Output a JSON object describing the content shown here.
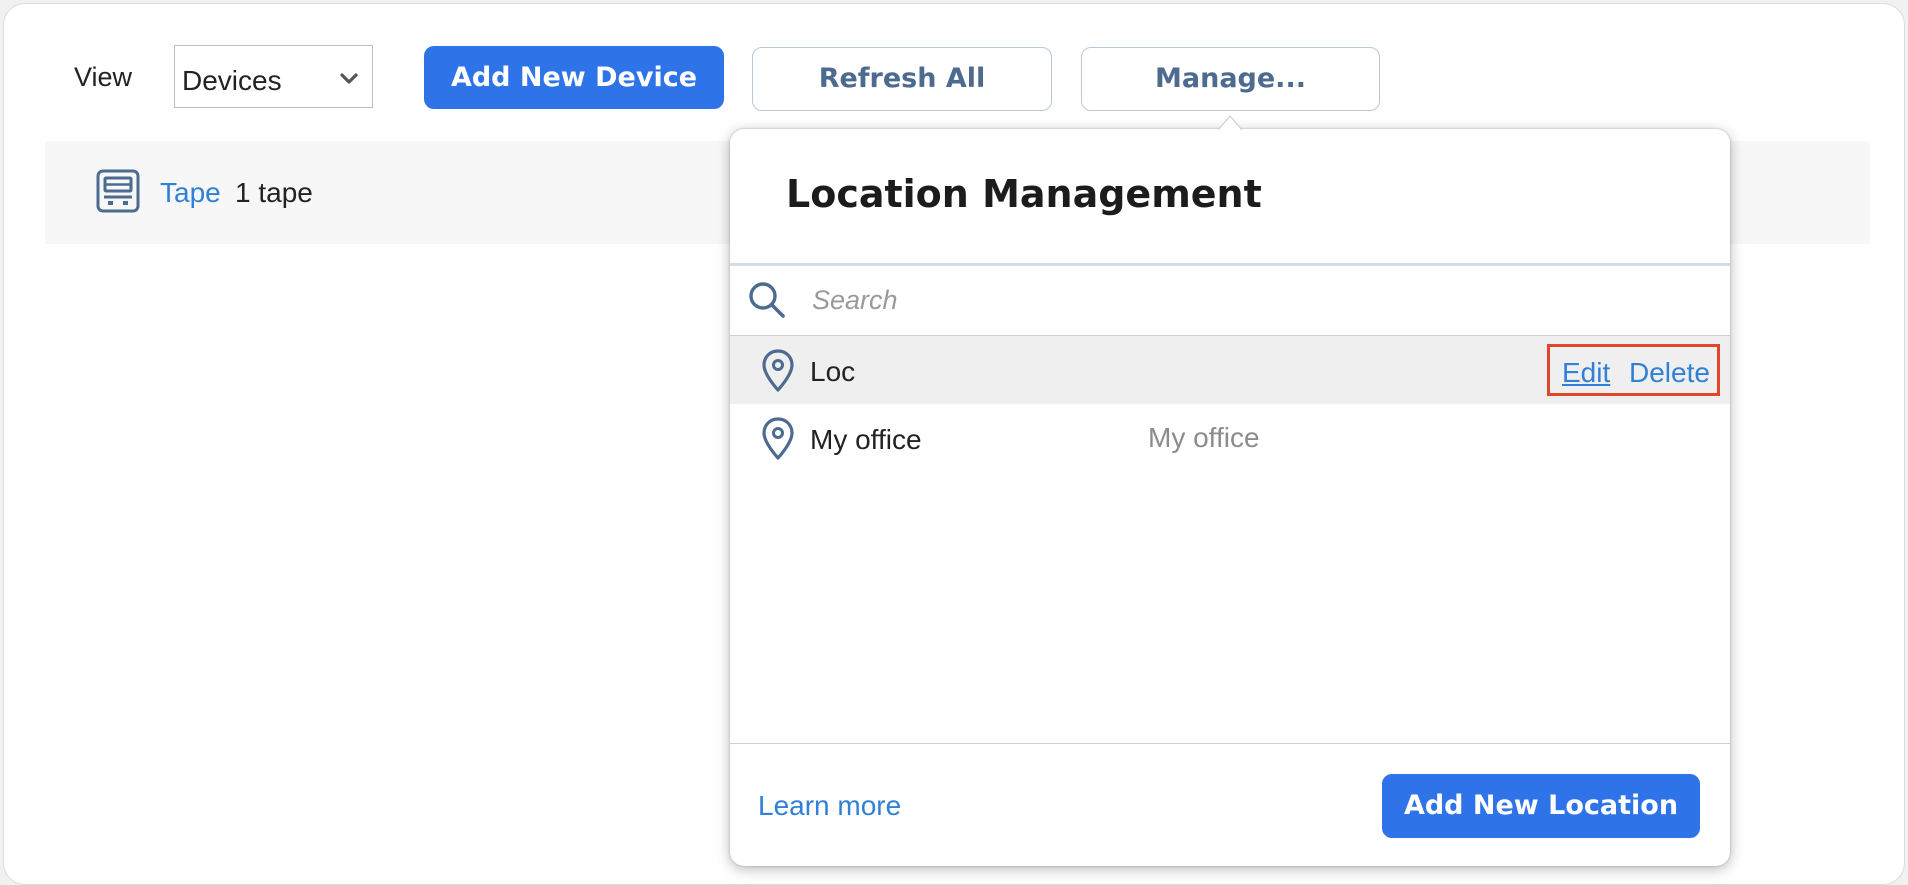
{
  "toolbar": {
    "view_label": "View",
    "view_select_value": "Devices",
    "add_device_label": "Add New Device",
    "refresh_label": "Refresh All",
    "manage_label": "Manage..."
  },
  "devices": [
    {
      "type_label": "Tape",
      "count_label": "1 tape",
      "icon": "tape-library-icon"
    }
  ],
  "popover": {
    "title": "Location Management",
    "search_placeholder": "Search",
    "search_value": "",
    "locations": [
      {
        "name": "Loc",
        "description": "",
        "selected": true,
        "edit_label": "Edit",
        "delete_label": "Delete"
      },
      {
        "name": "My office",
        "description": "My office",
        "selected": false
      }
    ],
    "learn_more_label": "Learn more",
    "add_location_label": "Add New Location"
  },
  "colors": {
    "primary": "#2f73e9",
    "link": "#2f80d6",
    "highlight_box": "#e0462c",
    "icon": "#4d6a8f"
  }
}
